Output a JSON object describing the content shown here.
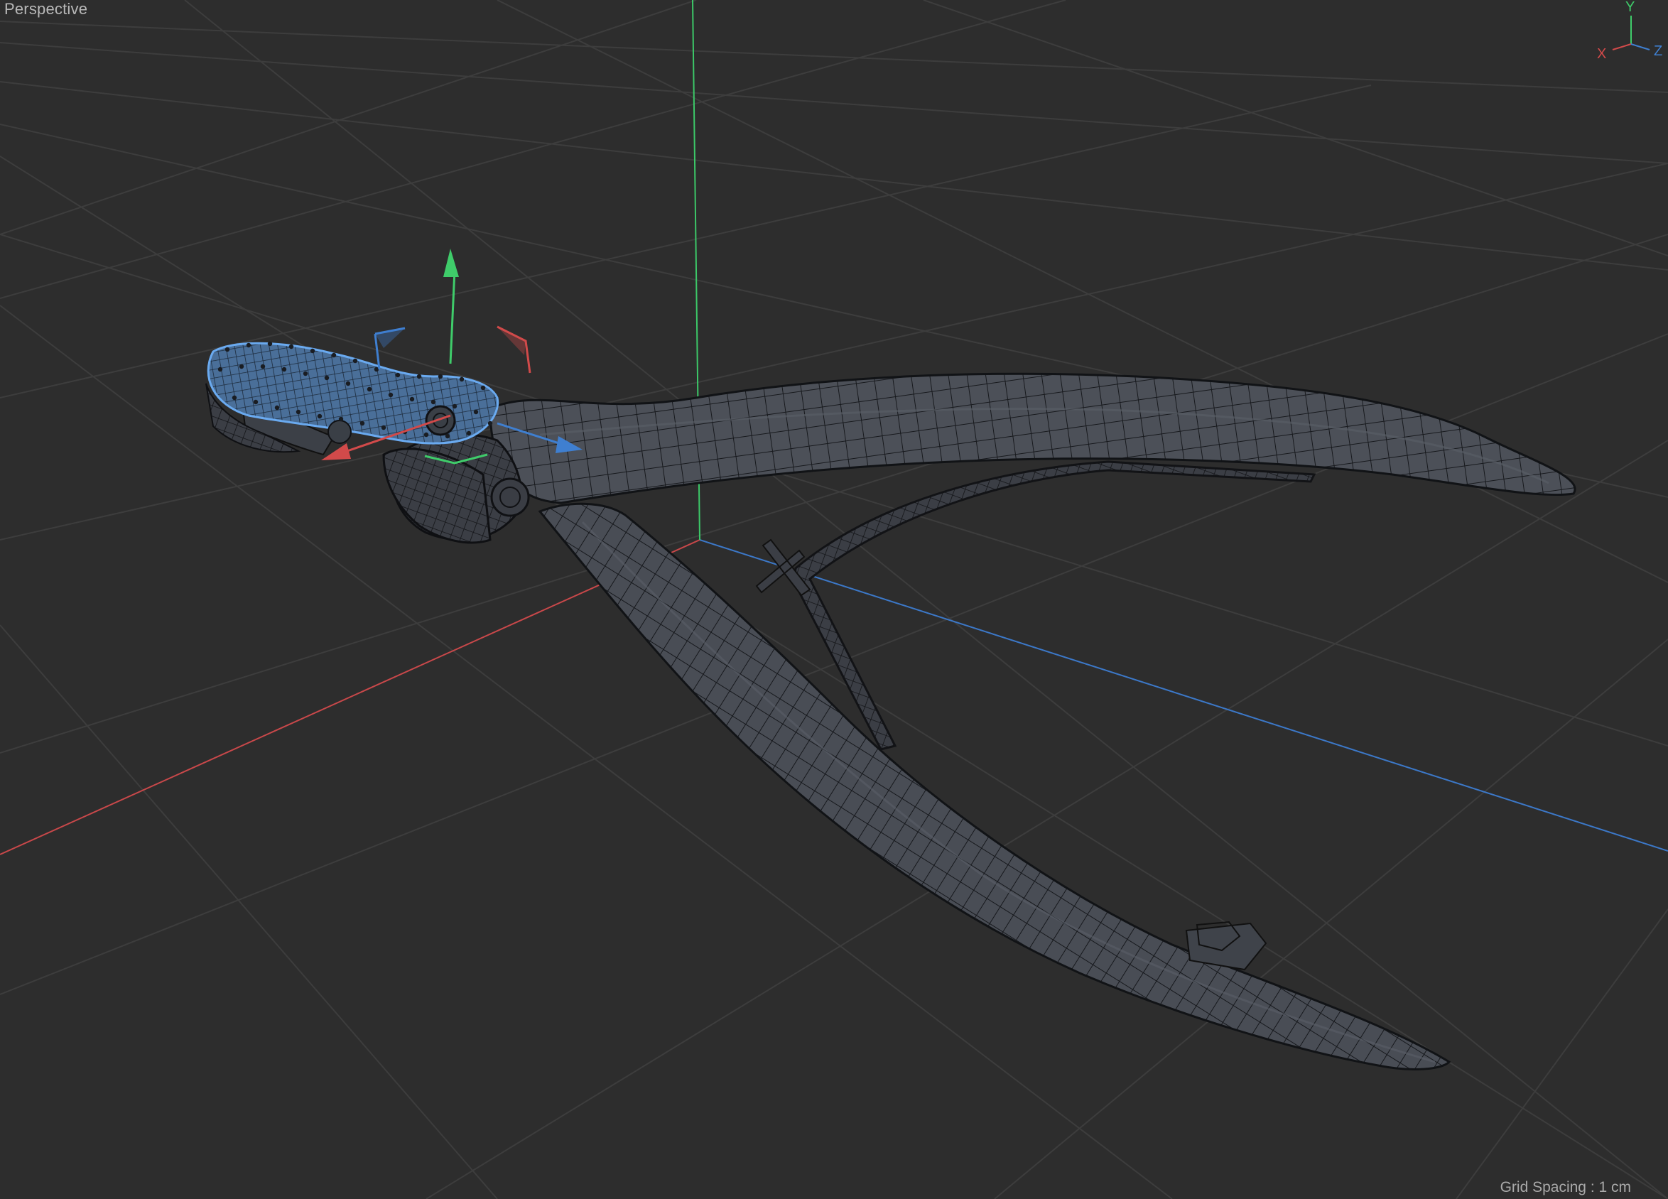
{
  "viewport": {
    "view_name": "Perspective",
    "grid_spacing": "Grid Spacing : 1 cm"
  },
  "axis_indicator": {
    "x_label": "X",
    "y_label": "Y",
    "z_label": "Z"
  },
  "colors": {
    "background": "#2d2d2d",
    "grid_line": "#3e3e3e",
    "x_axis": "#d24a4a",
    "y_axis": "#3fcc6a",
    "z_axis": "#3f7fd0",
    "mesh_fill": "#4a4e56",
    "mesh_wire": "#16181c",
    "selection": "#5b9ee6"
  },
  "icons": {
    "gizmo": "move-gizmo-icon",
    "orientation": "axis-orientation-icon"
  }
}
